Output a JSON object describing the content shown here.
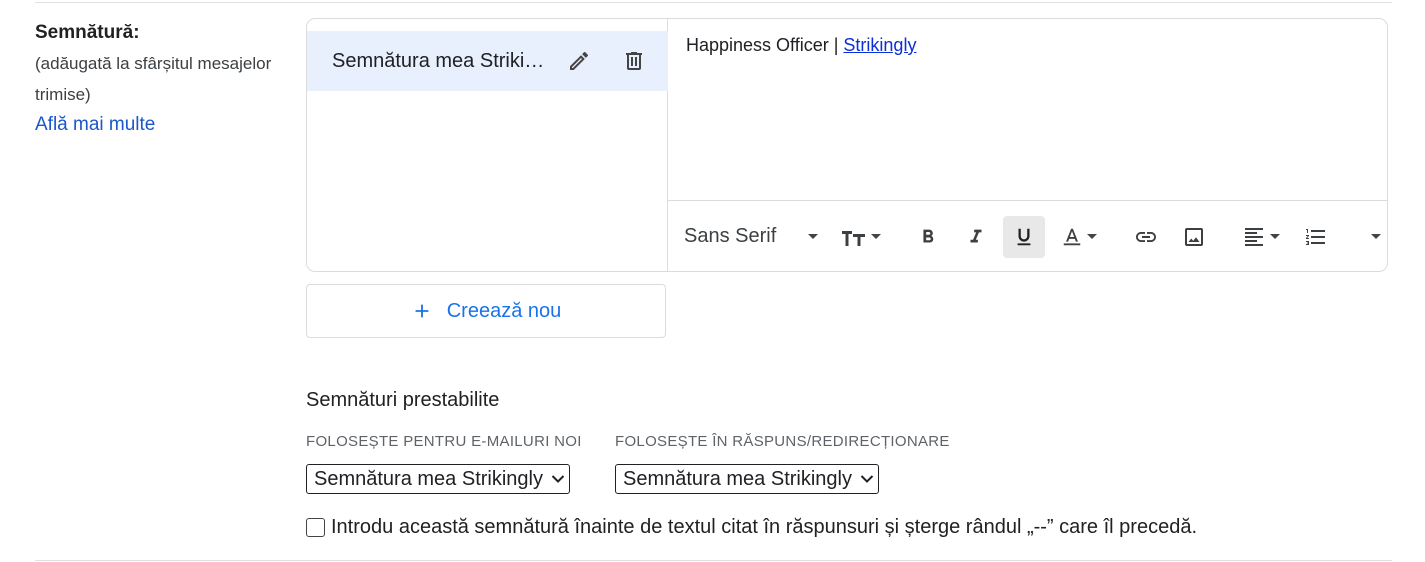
{
  "signature_section": {
    "title": "Semnătură:",
    "description": "(adăugată la sfârșitul mesajelor trimise)",
    "learn_more": "Află mai multe"
  },
  "signature_list": {
    "items": [
      {
        "name": "Semnătura mea Strikingly"
      }
    ]
  },
  "editor": {
    "text_prefix": "Happiness Officer | ",
    "link_text": "Strikingly",
    "toolbar": {
      "font": "Sans Serif",
      "items": [
        "font-size",
        "bold",
        "italic",
        "underline",
        "text-color",
        "link",
        "image",
        "align",
        "numbered-list",
        "more-formatting"
      ],
      "active": "underline"
    }
  },
  "create_new": {
    "label": "Creează nou"
  },
  "defaults": {
    "title": "Semnături prestabilite",
    "new_emails_label": "FOLOSEȘTE PENTRU E-MAILURI NOI",
    "new_emails_value": "Semnătura mea Strikingly",
    "reply_label": "FOLOSEȘTE ÎN RĂSPUNS/REDIRECȚIONARE",
    "reply_value": "Semnătura mea Strikingly"
  },
  "insert_before_quoted": {
    "label": "Introdu această semnătură înainte de textul citat în răspunsuri și șterge rândul „--” care îl precedă.",
    "checked": false
  },
  "colors": {
    "selected_bg": "#e8f0fe",
    "link_blue": "#1a57c9",
    "accent_blue": "#1a73e8"
  }
}
